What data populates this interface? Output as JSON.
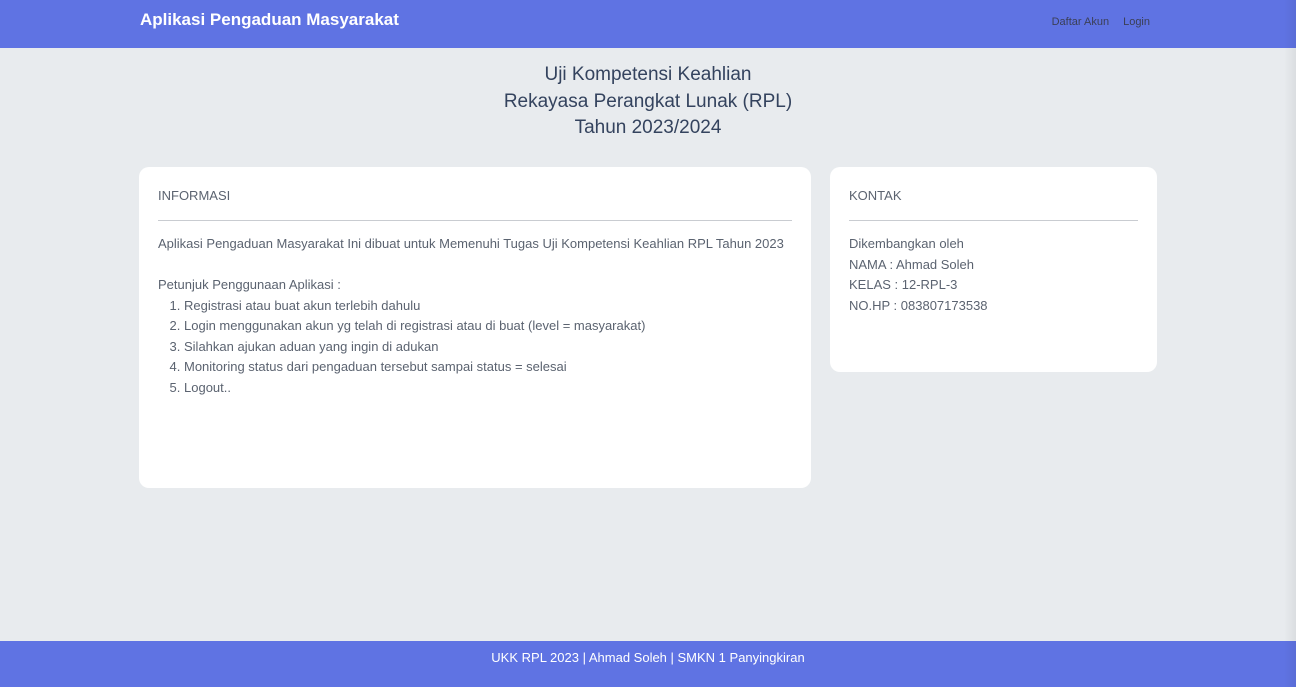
{
  "navbar": {
    "brand": "Aplikasi Pengaduan Masyarakat",
    "links": [
      "Daftar Akun",
      "Login"
    ]
  },
  "hero": {
    "line1": "Uji Kompetensi Keahlian",
    "line2": "Rekayasa Perangkat Lunak (RPL)",
    "line3": "Tahun 2023/2024"
  },
  "info_card": {
    "title": "INFORMASI",
    "description": "Aplikasi Pengaduan Masyarakat Ini dibuat untuk Memenuhi Tugas Uji Kompetensi Keahlian RPL Tahun 2023",
    "instructions_heading": "Petunjuk Penggunaan Aplikasi :",
    "steps": [
      "Registrasi atau buat akun terlebih dahulu",
      "Login menggunakan akun yg telah di registrasi atau di buat (level = masyarakat)",
      "Silahkan ajukan aduan yang ingin di adukan",
      "Monitoring status dari pengaduan tersebut sampai status = selesai",
      "Logout.."
    ]
  },
  "contact_card": {
    "title": "KONTAK",
    "lines": [
      "Dikembangkan oleh",
      "NAMA : Ahmad Soleh",
      "KELAS : 12-RPL-3",
      "NO.HP : 083807173538"
    ]
  },
  "footer": {
    "text": "UKK RPL 2023 | Ahmad Soleh | SMKN 1 Panyingkiran"
  },
  "colors": {
    "navbar_bg": "#5f73e3",
    "page_bg": "#e8ebee",
    "card_bg": "#ffffff",
    "hero_text": "#34435e"
  }
}
